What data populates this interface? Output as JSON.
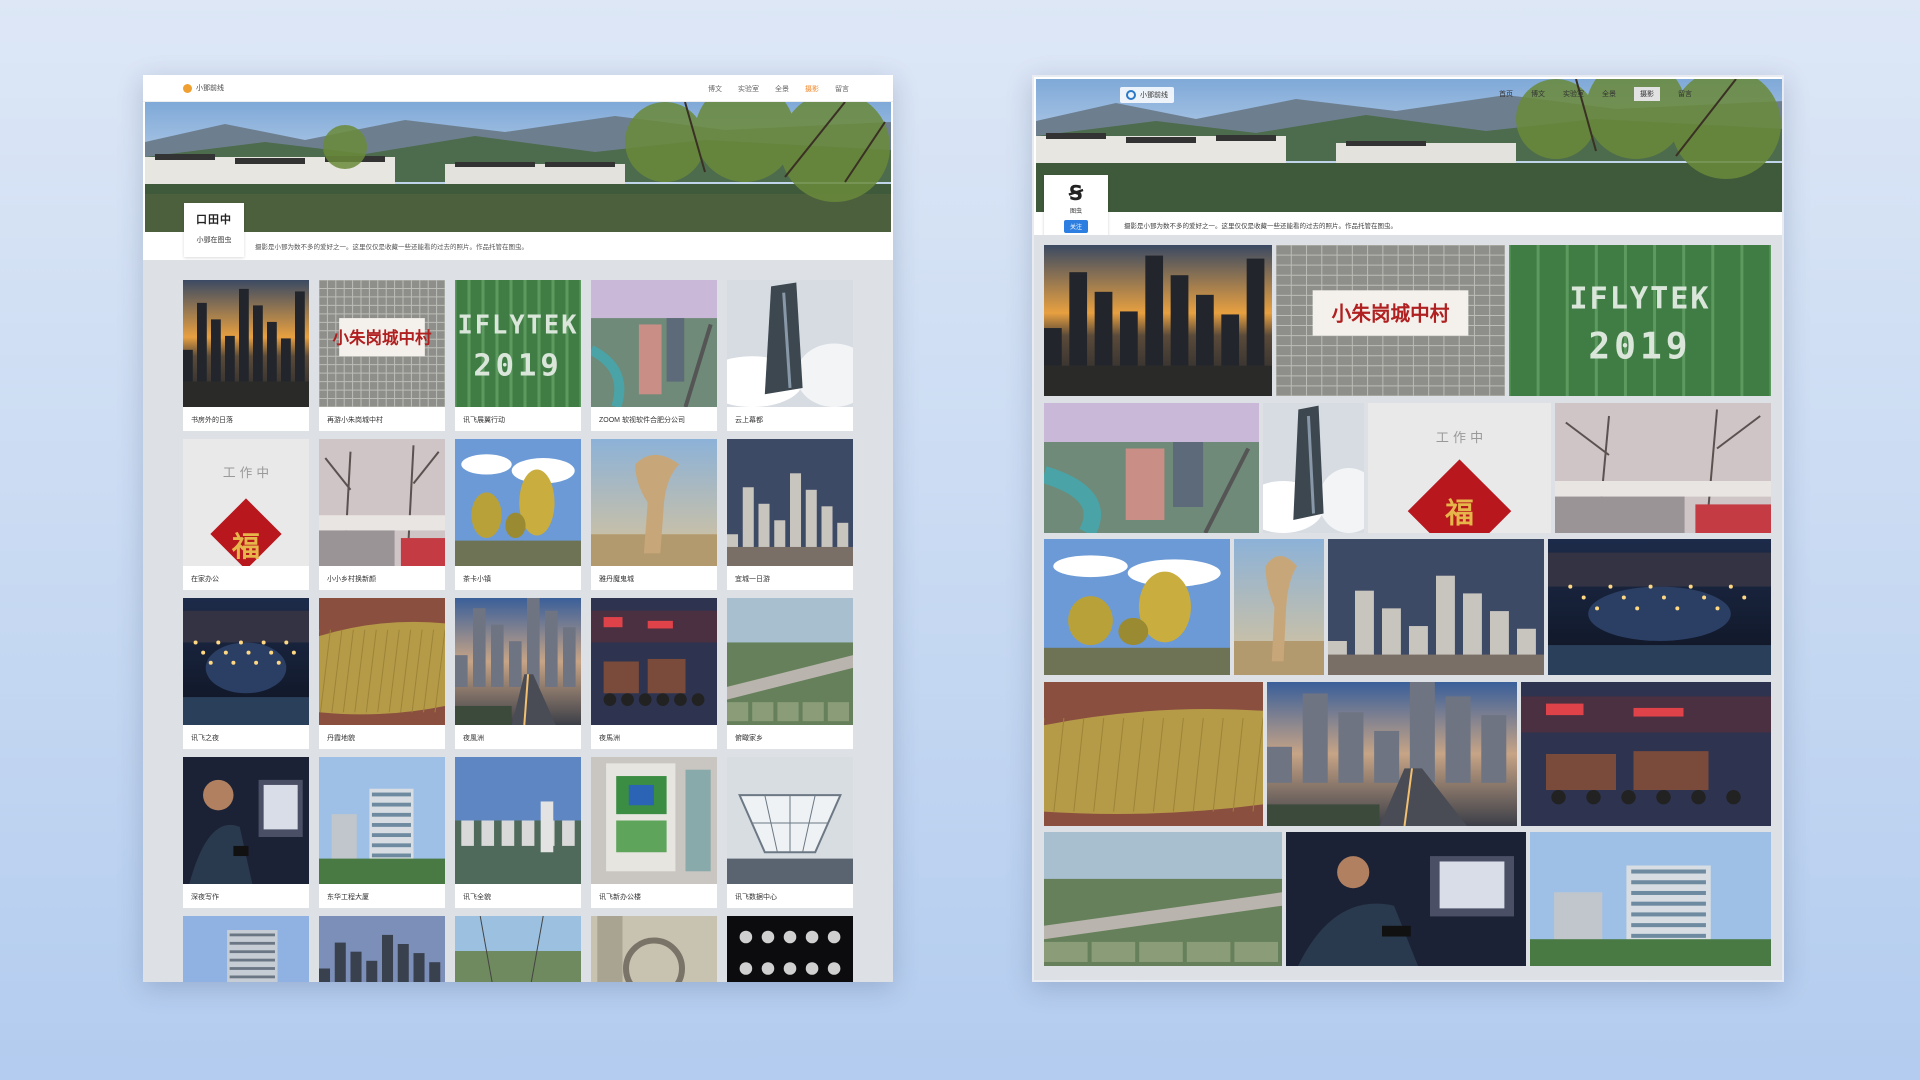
{
  "left_window": {
    "brand": "小鄧前线",
    "nav": [
      "博文",
      "实验室",
      "全景",
      "摄影",
      "留言"
    ],
    "active_nav": "摄影",
    "avatar_logo": "口田中",
    "avatar_name": "小鄧在图虫",
    "description": "摄影是小鄧为数不多的爱好之一。这里仅仅是收藏一些还能看的过去的照片。作品托管在图虫。",
    "photos": [
      {
        "caption": "书房外的日落",
        "scene": "sunset"
      },
      {
        "caption": "再游小朱岗城中村",
        "scene": "sign"
      },
      {
        "caption": "讯飞展翼行动",
        "scene": "field"
      },
      {
        "caption": "ZOOM 软视软件合肥分公司",
        "scene": "aerial-city"
      },
      {
        "caption": "云上幕都",
        "scene": "clouds-tower"
      },
      {
        "caption": "在家办公",
        "scene": "fu"
      },
      {
        "caption": "小小乡村换新颜",
        "scene": "village"
      },
      {
        "caption": "茶卡小镇",
        "scene": "trees"
      },
      {
        "caption": "雅丹魔鬼城",
        "scene": "rock"
      },
      {
        "caption": "宜城一日游",
        "scene": "city"
      },
      {
        "caption": "讯飞之夜",
        "scene": "night-lake"
      },
      {
        "caption": "丹霞地貌",
        "scene": "danxia"
      },
      {
        "caption": "夜風洲",
        "scene": "dusk-road"
      },
      {
        "caption": "夜馬洲",
        "scene": "night-market"
      },
      {
        "caption": "俯瞰家乡",
        "scene": "countryside"
      },
      {
        "caption": "深夜写作",
        "scene": "writing"
      },
      {
        "caption": "东华工程大厦",
        "scene": "building"
      },
      {
        "caption": "讯飞全貌",
        "scene": "campus"
      },
      {
        "caption": "讯飞新办公楼",
        "scene": "roof"
      },
      {
        "caption": "讯飞数据中心",
        "scene": "dome"
      }
    ],
    "partial_row": [
      "sky-tower",
      "skyline",
      "street",
      "circle",
      "moons"
    ]
  },
  "right_window": {
    "brand": "小鄧前线",
    "nav": [
      "首页",
      "博文",
      "实验室",
      "全景",
      "摄影",
      "留言"
    ],
    "active_nav": "摄影",
    "avatar_glyph": "Ꞩ",
    "avatar_name": "图虫",
    "follow_button": "关注",
    "description": "摄影是小鄧为数不多的爱好之一。这里仅仅是收藏一些还能看的过去的照片。作品托管在图虫。",
    "sign_text": "小朱岗城中村",
    "field_text": "IFLYTEK 2019",
    "fu_header": "工 作 中",
    "fu_char": "福"
  },
  "colors": {
    "accent": "#f08a2c",
    "button": "#2c7fe0",
    "grid_bg": "#dde1e6"
  }
}
